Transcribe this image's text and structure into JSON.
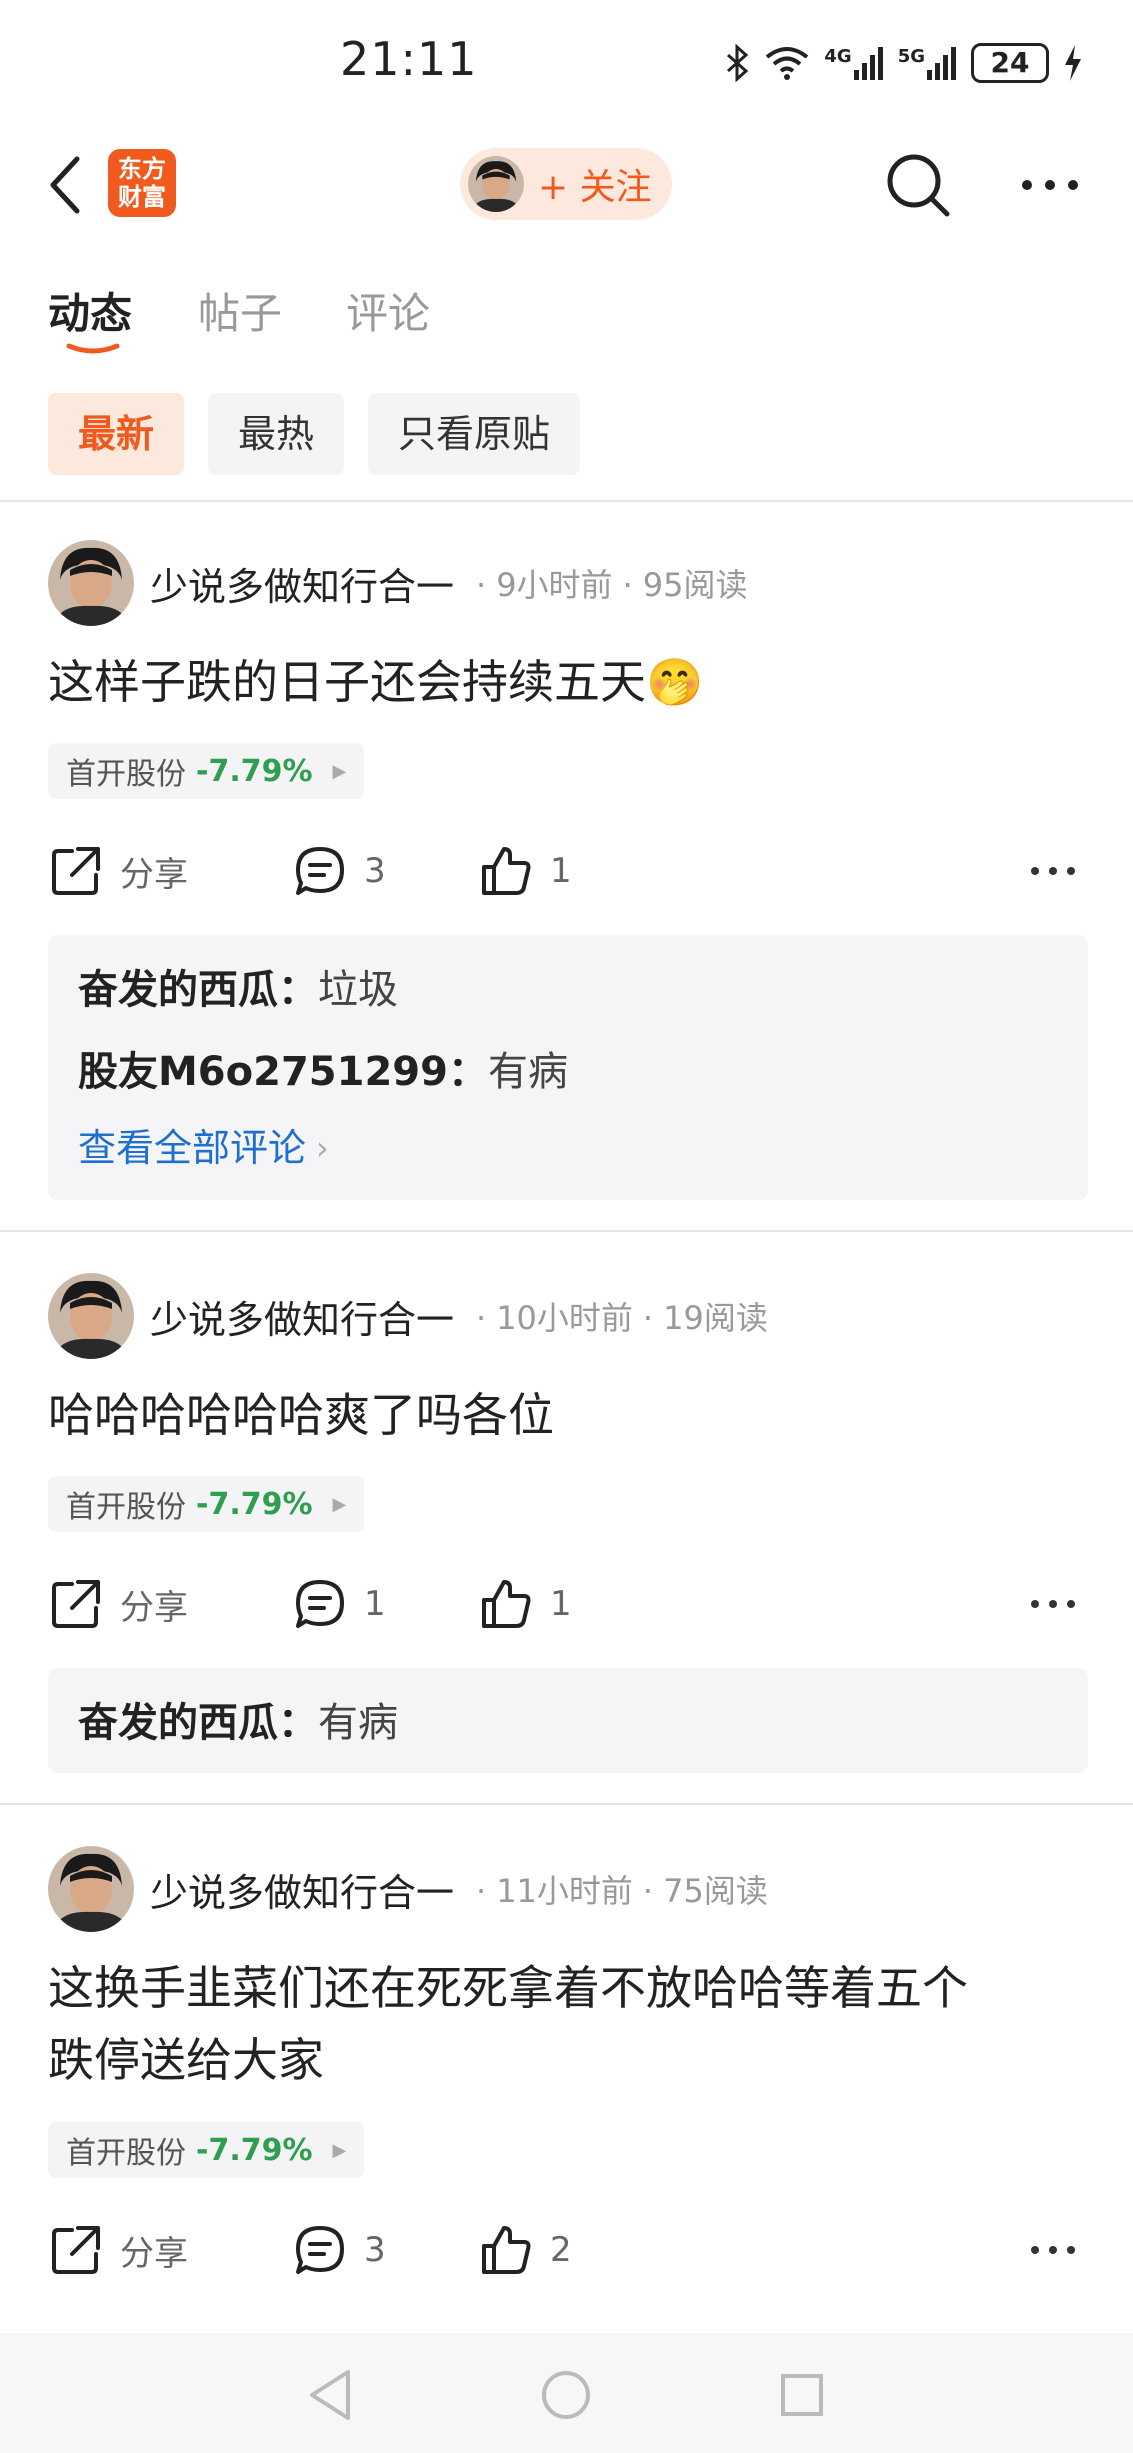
{
  "status_bar": {
    "time": "21:11",
    "battery": "24",
    "network_1": "4G",
    "network_2": "5G"
  },
  "nav": {
    "logo_line1": "东方",
    "logo_line2": "财富",
    "follow_label": "+ 关注"
  },
  "tabs": [
    {
      "label": "动态",
      "active": true
    },
    {
      "label": "帖子",
      "active": false
    },
    {
      "label": "评论",
      "active": false
    }
  ],
  "filters": [
    {
      "label": "最新",
      "active": true
    },
    {
      "label": "最热",
      "active": false
    },
    {
      "label": "只看原贴",
      "active": false
    }
  ],
  "posts": [
    {
      "author": "少说多做知行合一",
      "time": "9小时前",
      "reads": "95阅读",
      "body": "这样子跌的日子还会持续五天🤭",
      "stock_name": "首开股份",
      "stock_change": "-7.79%",
      "share_label": "分享",
      "comment_count": "3",
      "like_count": "1",
      "comments": [
        {
          "user": "奋发的西瓜",
          "text": "垃圾"
        },
        {
          "user": "股友M6o2751299",
          "text": "有病"
        }
      ],
      "view_all": "查看全部评论"
    },
    {
      "author": "少说多做知行合一",
      "time": "10小时前",
      "reads": "19阅读",
      "body": "哈哈哈哈哈哈爽了吗各位",
      "stock_name": "首开股份",
      "stock_change": "-7.79%",
      "share_label": "分享",
      "comment_count": "1",
      "like_count": "1",
      "comments": [
        {
          "user": "奋发的西瓜",
          "text": "有病"
        }
      ]
    },
    {
      "author": "少说多做知行合一",
      "time": "11小时前",
      "reads": "75阅读",
      "body_line1": "这换手韭菜们还在死死拿着不放哈哈等着五个",
      "body_line2": "跌停送给大家",
      "stock_name": "首开股份",
      "stock_change": "-7.79%",
      "share_label": "分享",
      "comment_count": "3",
      "like_count": "2"
    }
  ],
  "separator": "：",
  "dot": "·",
  "colors": {
    "accent": "#f05a1e",
    "accent_bg": "#fde8de",
    "stock_down": "#2e9e4f",
    "link": "#1f6fcf"
  }
}
